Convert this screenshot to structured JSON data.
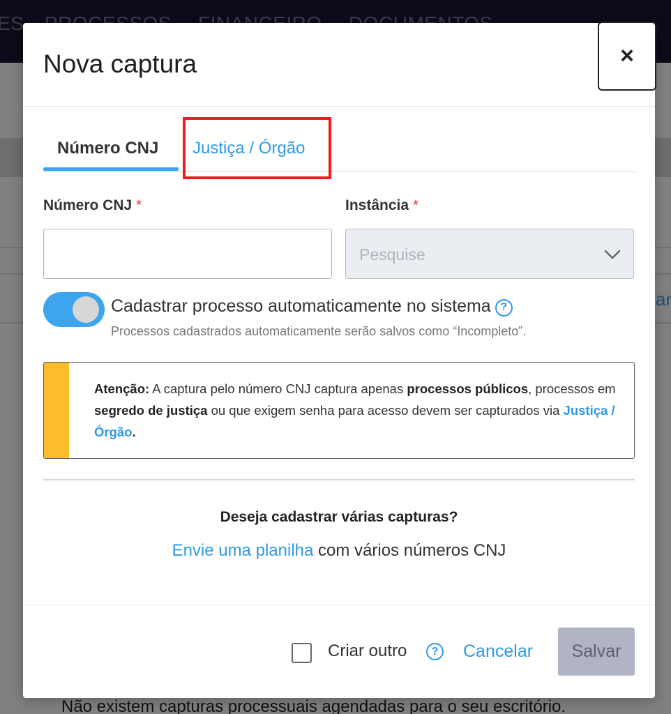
{
  "background": {
    "nav_items": [
      "ES",
      "PROCESSOS",
      "FINANCEIRO",
      "DOCUMENTOS"
    ],
    "right_fragment": "ar",
    "bottom_message": "Não existem capturas processuais agendadas para o seu escritório."
  },
  "modal": {
    "title": "Nova captura",
    "close_label": "×",
    "tabs": [
      {
        "label": "Número CNJ",
        "active": true
      },
      {
        "label": "Justiça / Órgão",
        "active": false
      }
    ],
    "fields": {
      "cnj_label": "Número CNJ",
      "cnj_value": "",
      "instancia_label": "Instância",
      "instancia_placeholder": "Pesquise",
      "required_mark": "*"
    },
    "toggle": {
      "on": true,
      "label": "Cadastrar processo automaticamente no sistema",
      "help": "?",
      "sub": "Processos cadastrados automaticamente serão salvos como “Incompleto”."
    },
    "alert": {
      "prefix": "Atenção:",
      "text1": " A captura pelo número CNJ captura apenas ",
      "bold1": "processos públicos",
      "text2": ", processos em ",
      "bold2": "segredo de justiça",
      "text3": " ou que exigem senha para acesso devem ser capturados via ",
      "link": "Justiça / Órgão",
      "suffix": "."
    },
    "multi": {
      "title": "Deseja cadastrar várias capturas?",
      "link": "Envie uma planilha",
      "rest": " com vários números CNJ"
    },
    "footer": {
      "checkbox_label": "Criar outro",
      "checkbox_checked": false,
      "help": "?",
      "cancel": "Cancelar",
      "save": "Salvar"
    }
  },
  "colors": {
    "accent": "#2e9ae6",
    "toggle_on": "#3da4ee",
    "alert_bar": "#fbbd2c",
    "highlight": "#ee1c1c",
    "save_disabled": "#b1b5c3"
  }
}
